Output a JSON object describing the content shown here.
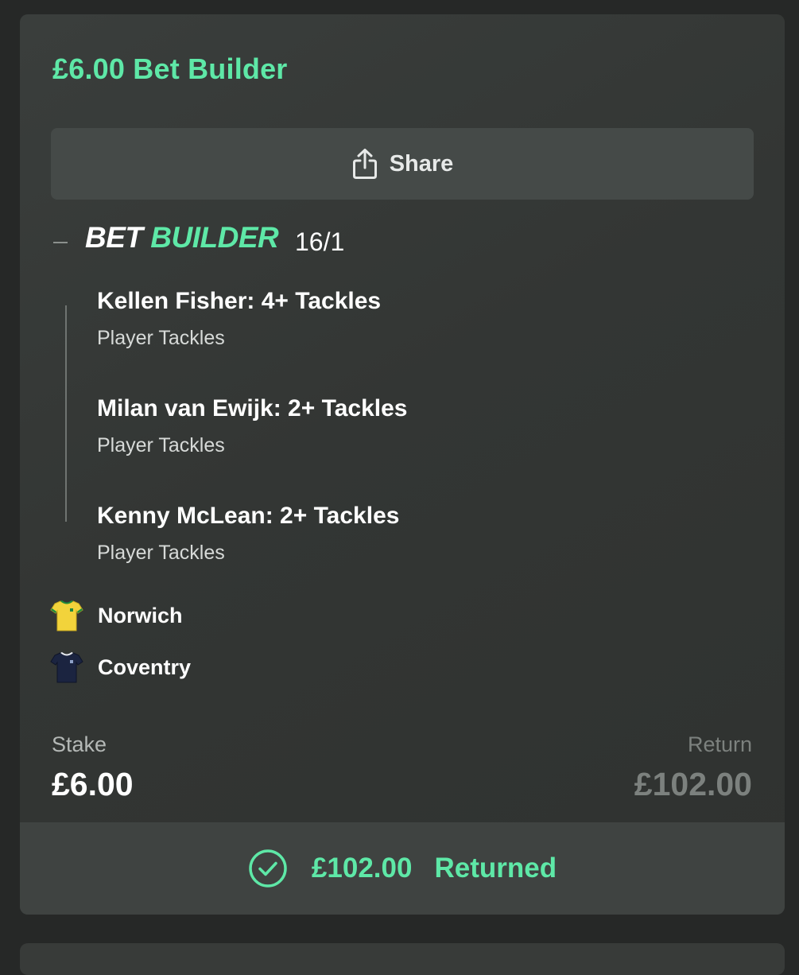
{
  "bet": {
    "title": "£6.00 Bet Builder",
    "share_label": "Share",
    "type_word_1": "BET",
    "type_word_2": "BUILDER",
    "odds": "16/1",
    "selections": [
      {
        "name": "Kellen Fisher: 4+ Tackles",
        "market": "Player Tackles"
      },
      {
        "name": "Milan van Ewijk: 2+ Tackles",
        "market": "Player Tackles"
      },
      {
        "name": "Kenny McLean: 2+ Tackles",
        "market": "Player Tackles"
      }
    ],
    "teams": [
      {
        "name": "Norwich",
        "icon": "yellow-green-shirt-icon"
      },
      {
        "name": "Coventry",
        "icon": "navy-shirt-icon"
      }
    ],
    "stake_label": "Stake",
    "stake_value": "£6.00",
    "return_label": "Return",
    "return_value": "£102.00",
    "returned_amount": "£102.00",
    "returned_text": "Returned"
  },
  "colors": {
    "accent": "#5ee8a7",
    "card_bg": "#343735",
    "page_bg": "#262827",
    "button_bg": "#454a48",
    "muted_text": "#7c817e"
  }
}
